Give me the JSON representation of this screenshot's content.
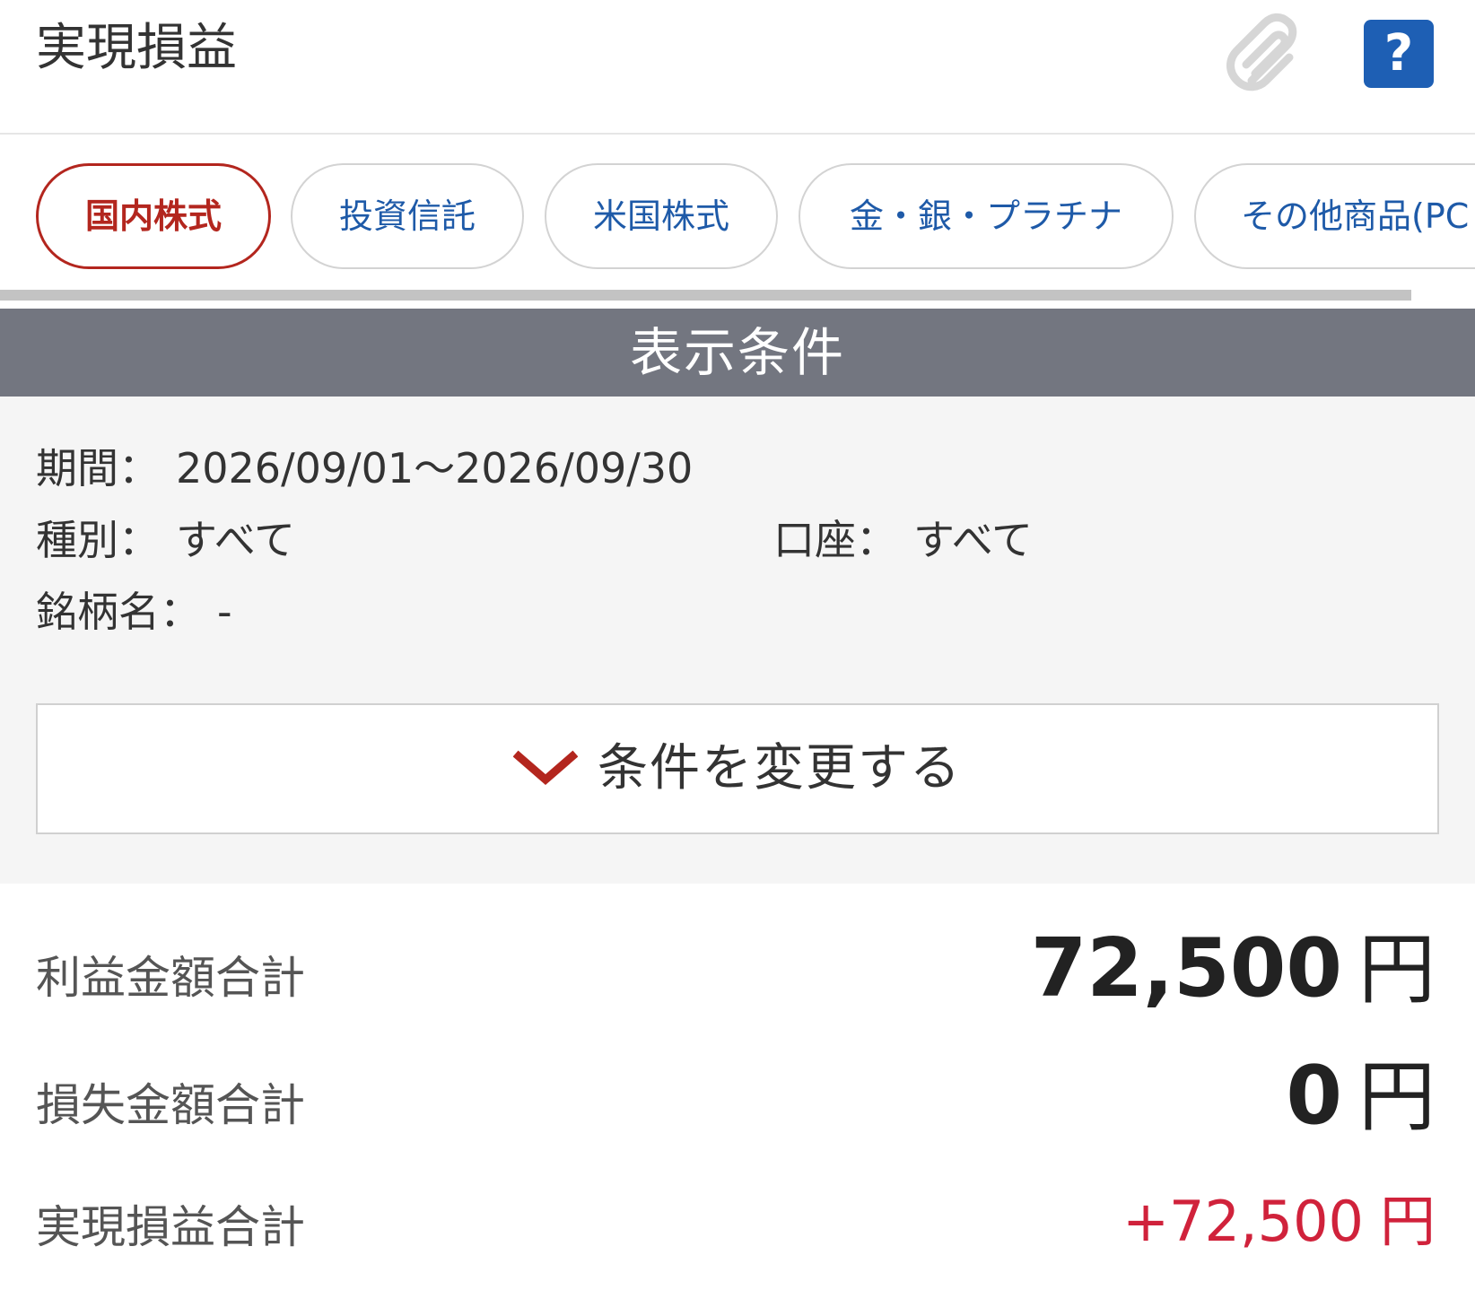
{
  "header": {
    "title": "実現損益",
    "attach_icon": "paperclip-icon",
    "help_label": "?"
  },
  "tabs": [
    {
      "label": "国内株式",
      "active": true
    },
    {
      "label": "投資信託",
      "active": false
    },
    {
      "label": "米国株式",
      "active": false
    },
    {
      "label": "金・銀・プラチナ",
      "active": false
    },
    {
      "label": "その他商品(PC",
      "active": false
    }
  ],
  "conditions": {
    "heading": "表示条件",
    "period_label": "期間：",
    "period_value": "2026/09/01〜2026/09/30",
    "type_label": "種別：",
    "type_value": "すべて",
    "account_label": "口座：",
    "account_value": "すべて",
    "name_label": "銘柄名：",
    "name_value": "-",
    "change_button": "条件を変更する"
  },
  "summary": {
    "profit_label": "利益金額合計",
    "profit_value": "72,500",
    "loss_label": "損失金額合計",
    "loss_value": "0",
    "realized_label": "実現損益合計",
    "realized_value": "+72,500",
    "unit": "円"
  },
  "colors": {
    "active_tab": "#b3261e",
    "tab_text": "#1e5aa8",
    "help_button": "#1e5fb4",
    "condition_header": "#737680",
    "positive": "#d0223b"
  }
}
